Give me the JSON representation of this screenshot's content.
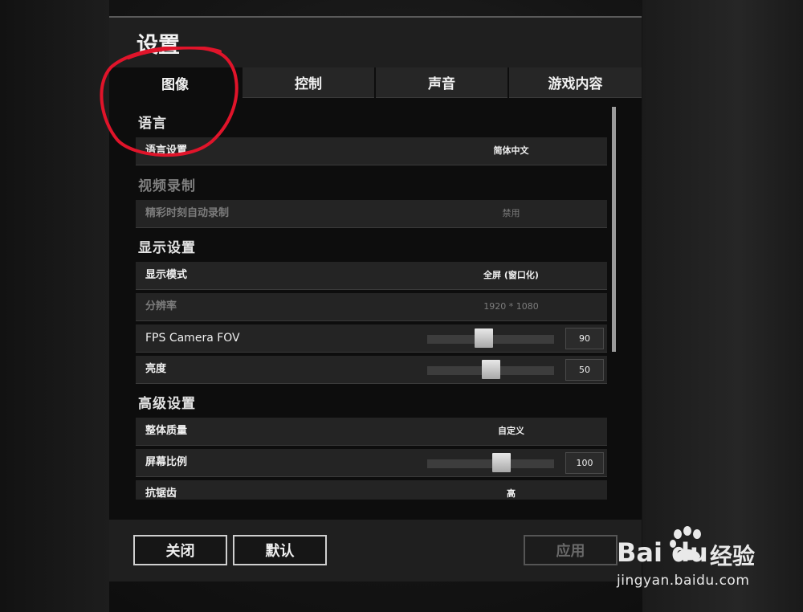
{
  "window": {
    "title": "设置"
  },
  "tabs": [
    {
      "label": "图像",
      "active": true
    },
    {
      "label": "控制",
      "active": false
    },
    {
      "label": "声音",
      "active": false
    },
    {
      "label": "游戏内容",
      "active": false
    }
  ],
  "sections": {
    "language": {
      "title": "语言",
      "rows": [
        {
          "label": "语言设置",
          "value": "简体中文"
        }
      ]
    },
    "video_recording": {
      "title": "视频录制",
      "rows": [
        {
          "label": "精彩时刻自动录制",
          "value": "禁用"
        }
      ]
    },
    "display": {
      "title": "显示设置",
      "rows": [
        {
          "label": "显示模式",
          "value": "全屏 (窗口化)"
        },
        {
          "label": "分辨率",
          "value": "1920 * 1080"
        },
        {
          "label": "FPS Camera FOV",
          "value": "90",
          "slider_fraction": 0.44
        },
        {
          "label": "亮度",
          "value": "50",
          "slider_fraction": 0.5
        }
      ]
    },
    "advanced": {
      "title": "高级设置",
      "rows": [
        {
          "label": "整体质量",
          "value": "自定义"
        },
        {
          "label": "屏幕比例",
          "value": "100",
          "slider_fraction": 0.6
        },
        {
          "label": "抗锯齿",
          "value": "高"
        }
      ]
    }
  },
  "footer": {
    "close_label": "关闭",
    "default_label": "默认",
    "apply_label": "应用"
  },
  "watermark": {
    "logo_text": "Bai du",
    "site_name": "经验",
    "url": "jingyan.baidu.com"
  },
  "colors": {
    "panel_bg": "#0d0d0d",
    "row_bg": "#242424",
    "annotation_red": "#e0142a"
  }
}
